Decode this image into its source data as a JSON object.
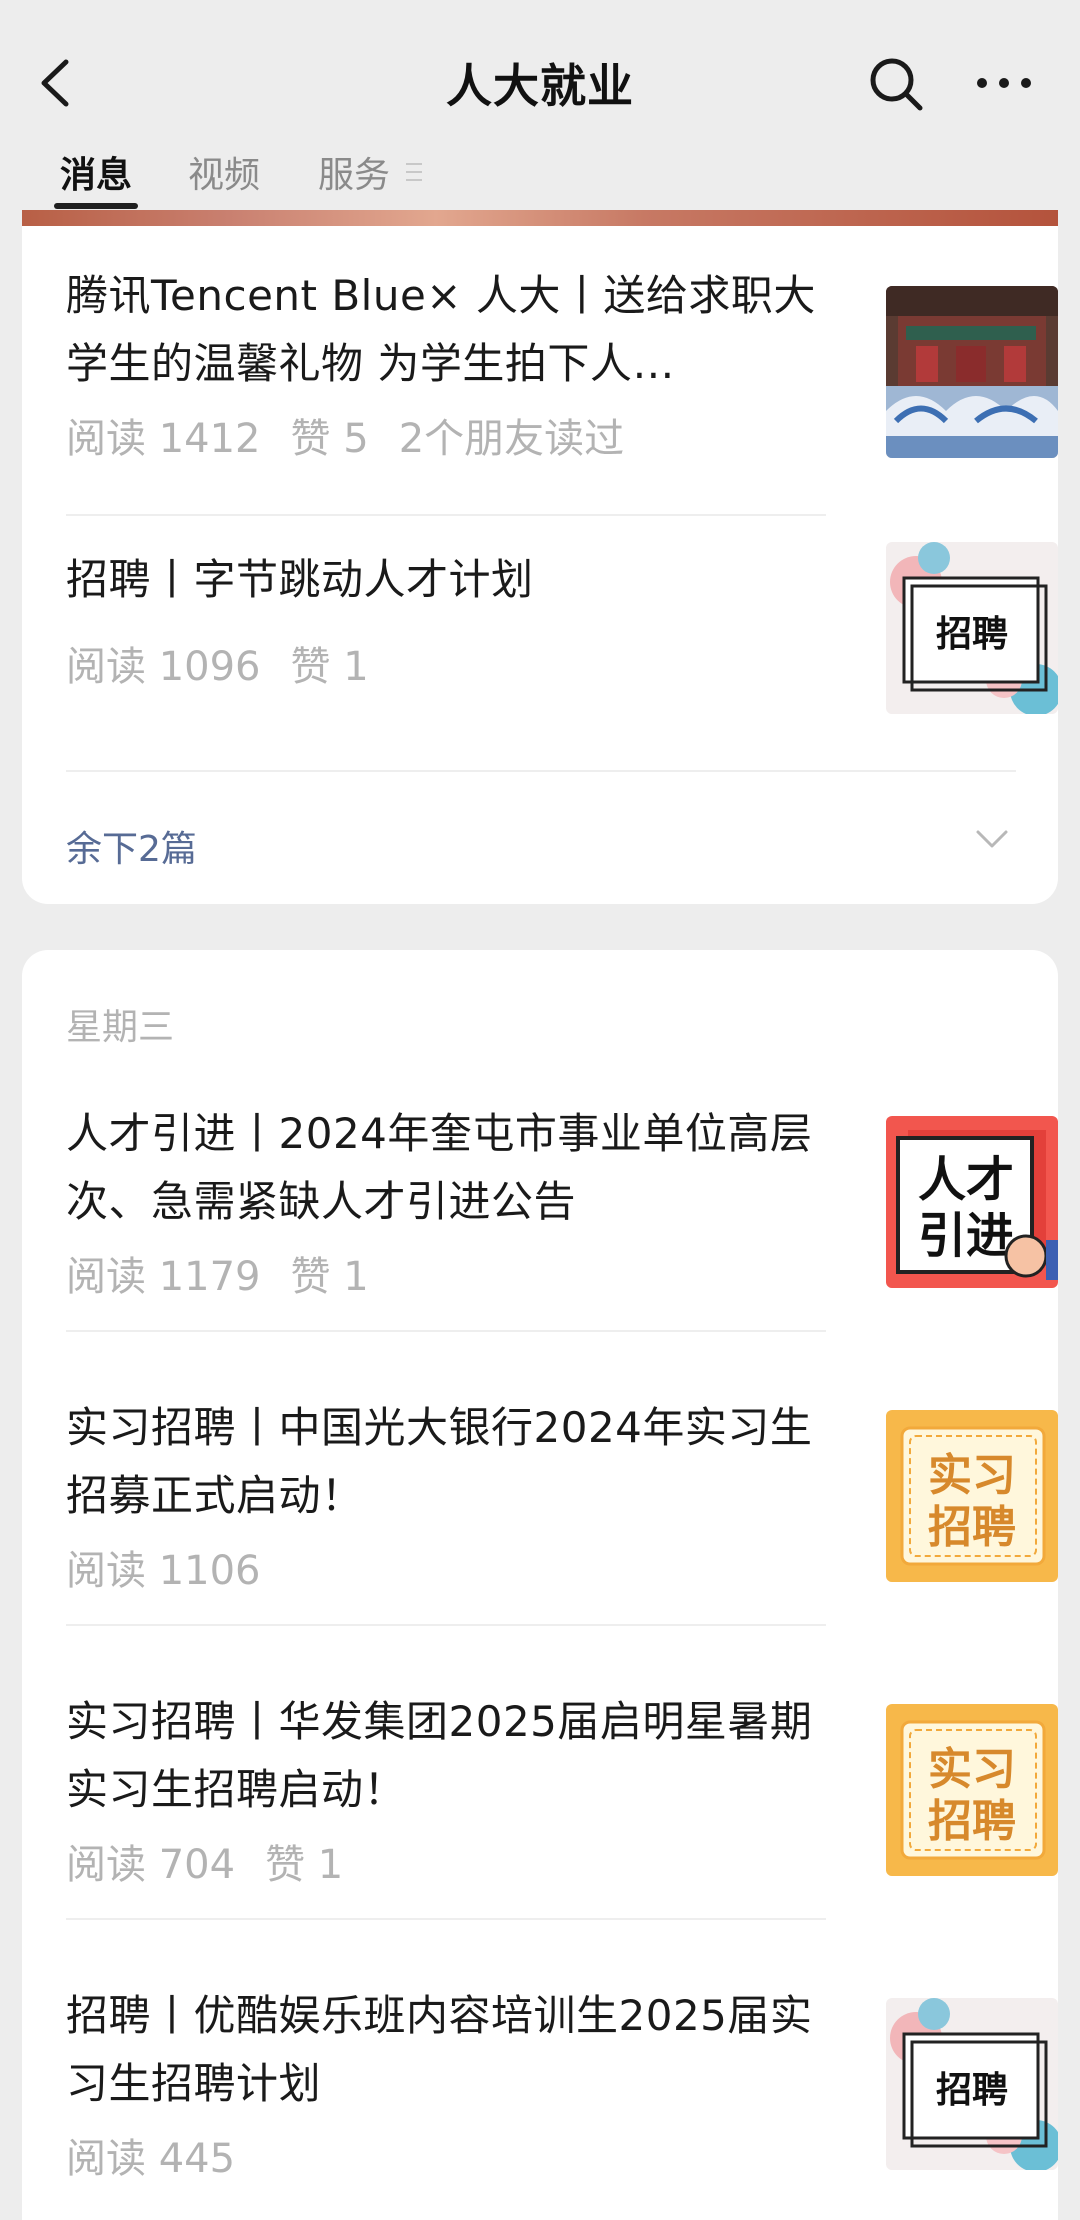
{
  "header": {
    "title": "人大就业",
    "tabs": [
      "消息",
      "视频",
      "服务"
    ]
  },
  "colors": {
    "accent_link": "#576b95",
    "meta_gray": "#b3b3b3"
  },
  "group1": {
    "items": [
      {
        "title": "腾讯Tencent Blue× 人大丨送给求职大学生的温馨礼物 为学生拍下人…",
        "meta": [
          "阅读 1412",
          "赞 5",
          "2个朋友读过"
        ],
        "thumb": "photo-building"
      },
      {
        "title": "招聘丨字节跳动人才计划",
        "meta": [
          "阅读 1096",
          "赞 1"
        ],
        "thumb": "招聘"
      }
    ],
    "more": "余下2篇"
  },
  "group2": {
    "date": "星期三",
    "items": [
      {
        "title": "人才引进丨2024年奎屯市事业单位高层次、急需紧缺人才引进公告",
        "meta": [
          "阅读 1179",
          "赞 1"
        ],
        "thumb": [
          "人才",
          "引进"
        ]
      },
      {
        "title": "实习招聘丨中国光大银行2024年实习生招募正式启动！",
        "meta": [
          "阅读 1106"
        ],
        "thumb": [
          "实习",
          "招聘"
        ]
      },
      {
        "title": "实习招聘丨华发集团2025届启明星暑期实习生招聘启动！",
        "meta": [
          "阅读 704",
          "赞 1"
        ],
        "thumb": [
          "实习",
          "招聘"
        ]
      },
      {
        "title": "招聘丨优酷娱乐班内容培训生2025届实习生招聘计划",
        "meta": [
          "阅读 445"
        ],
        "thumb": "招聘"
      }
    ]
  }
}
